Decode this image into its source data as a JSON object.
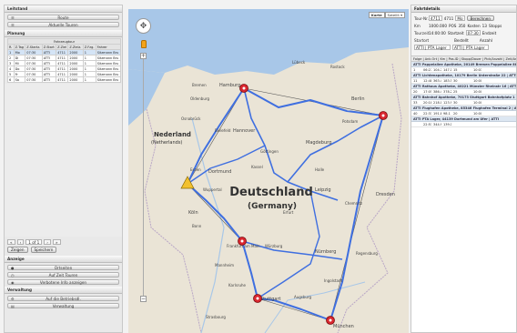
{
  "left": {
    "sections": {
      "leitstand": "Leitstand",
      "planung": "Planung",
      "anzeige": "Anzeige",
      "verwaltung": "Verwaltung"
    },
    "leitstand_buttons": [
      {
        "label": "Route",
        "icon": "list-icon"
      },
      {
        "label": "Aktuelle Touren",
        "icon": "list-icon"
      }
    ],
    "plan_table": {
      "group_header": "Fahrzeugtour",
      "columns": [
        "R.",
        "Z.Tag",
        "Z.Startz.",
        "Z.Start",
        "Z.Ziel",
        "Z.Zielz.",
        "Z.Fzg.",
        "Fahrer"
      ],
      "rows": [
        [
          "1",
          "Mo",
          "07:30",
          "ATTI",
          "4711",
          "2000",
          "1",
          "Sitzmann Bru"
        ],
        [
          "2",
          "Di",
          "07:30",
          "ATTI",
          "4711",
          "2000",
          "1",
          "Sitzmann Bru"
        ],
        [
          "3",
          "Mi",
          "07:30",
          "ATTI",
          "4711",
          "2000",
          "1",
          "Sitzmann Bru"
        ],
        [
          "4",
          "Do",
          "07:30",
          "ATTI",
          "4711",
          "2000",
          "1",
          "Sitzmann Bru"
        ],
        [
          "5",
          "Fr",
          "07:30",
          "ATTI",
          "4711",
          "2000",
          "1",
          "Sitzmann Bru"
        ],
        [
          "6",
          "Sa",
          "07:30",
          "ATTI",
          "4711",
          "2000",
          "1",
          "Sitzmann Bru"
        ]
      ]
    },
    "pager": {
      "first": "«",
      "prev": "‹",
      "page": "1 of 1",
      "next": "›",
      "last": "»"
    },
    "actions": {
      "zeigen": "Zeigen",
      "speichern": "Speichern"
    },
    "anzeige_buttons": [
      {
        "label": "Ortseiten",
        "icon": "pin-icon"
      },
      {
        "label": "Auf Zeit Touren",
        "icon": "clock-icon"
      },
      {
        "label": "Verbotene Info anzeigen",
        "icon": "eye-icon"
      }
    ],
    "verwaltung_buttons": [
      {
        "label": "Auf die Betriebsdl.",
        "icon": "gear-icon"
      },
      {
        "label": "Verwaltung",
        "icon": "folder-icon"
      }
    ]
  },
  "map": {
    "type_buttons": {
      "karte": "Karte",
      "satellit": "Satellit ▾"
    },
    "pan_glyph": "✥",
    "zoom_in": "+",
    "zoom_out": "−",
    "labels": [
      {
        "text": "Deutschland",
        "size": "big"
      },
      {
        "text": "(Germany)",
        "size": "big2"
      },
      {
        "text": "Nederland",
        "size": "mid"
      },
      {
        "text": "(Netherlands)",
        "size": "small"
      },
      {
        "text": "Hamburg"
      },
      {
        "text": "Bremen"
      },
      {
        "text": "Hannover"
      },
      {
        "text": "Berlin"
      },
      {
        "text": "Magdeburg"
      },
      {
        "text": "Leipzig"
      },
      {
        "text": "Dresden"
      },
      {
        "text": "Dortmund"
      },
      {
        "text": "Essen"
      },
      {
        "text": "Köln"
      },
      {
        "text": "Wuppertal"
      },
      {
        "text": "Kassel"
      },
      {
        "text": "Erfurt"
      },
      {
        "text": "Frankfurt am Main"
      },
      {
        "text": "Nürnberg"
      },
      {
        "text": "Stuttgart"
      },
      {
        "text": "München"
      },
      {
        "text": "Karlsruhe"
      },
      {
        "text": "Oldenburg"
      },
      {
        "text": "Bielefeld"
      },
      {
        "text": "Potsdam"
      },
      {
        "text": "Chemnitz"
      },
      {
        "text": "Regensburg"
      },
      {
        "text": "Augsburg"
      },
      {
        "text": "Mannheim"
      },
      {
        "text": "Würzburg"
      },
      {
        "text": "Osnabrück"
      },
      {
        "text": "Lübeck"
      },
      {
        "text": "Rostock"
      },
      {
        "text": "Bonn"
      },
      {
        "text": "Strasbourg"
      },
      {
        "text": "Ingolstadt"
      },
      {
        "text": "Halle"
      },
      {
        "text": "Göttingen"
      }
    ],
    "colors": {
      "land": "#eae4d6",
      "route": "#3f6fe0",
      "straight": "#555555",
      "marker": "#d9262e",
      "start": "#f2c12e",
      "water": "#a8c7e8"
    }
  },
  "right": {
    "title": "Fahrtdetails",
    "form": {
      "tour_label": "Tour-Nr.",
      "tour_value": "4711",
      "tag_label": "4711",
      "tag_value": "Mo",
      "berechnen": "Berechnen",
      "km_label": "Km",
      "km_value": "1000.000",
      "pos_label": "POS",
      "pos_value": "350",
      "kosten_label": "Kosten",
      "kosten_value": "13",
      "zeit_label": "Stopps",
      "tourzeit_label": "Tourzeit",
      "tourzeit_value": "14:00:00",
      "startzeit_label": "Startzeit",
      "startzeit_value": "07:30",
      "ende_label": "Endzeit",
      "startort_label": "Startort",
      "bestellt_label": "Bestellt",
      "anzahl_label": "Anzahl",
      "ziel_select": "ATTI | PTA Lager",
      "start_select": "ATTI | PTA Lager"
    },
    "list_header": "Folge | Ank.Ort | Km | Pos.ID | Stopp/Dauer | Pick/Anzahl | Zeit/Anzahl | Zeit ...",
    "groups": [
      {
        "title": "ATTI Pappelallee Apotheke, 20149 Bremen Pappelallee 88 | ATTI",
        "row": [
          "1",
          "06:27",
          "104.7",
          "147.1",
          "15",
          "",
          "10:03"
        ]
      },
      {
        "title": "ATTI Lichtenapotheke, 10179 Berlin Unterstraße 22 | ATTI",
        "row": [
          "11",
          "12:48",
          "363.4",
          "183.5",
          "30",
          "",
          "10:00"
        ]
      },
      {
        "title": "ATTI Rathaus Apotheke, 40221 Münster Rheinstr 16 | ATTI",
        "row": [
          "20",
          "17:05",
          "386.4",
          "378.2",
          "25",
          "",
          "10:00"
        ]
      },
      {
        "title": "ATTI Bahnhof Apotheke, 70173 Stuttgart Bahnhofplatz 1 | ATTI",
        "row": [
          "33",
          "20:18",
          "218.0",
          "123.9",
          "30",
          "",
          "10:00"
        ]
      },
      {
        "title": "ATTI Flughafen Apotheke, 85346 Flughafen Terminal 2 | ATTI",
        "row": [
          "40",
          "22:31",
          "191.8",
          "98.1",
          "20",
          "",
          "10:00"
        ]
      },
      {
        "title": "ATTI PTA Lager, 44139 Dortmund am Ufer | ATTI",
        "row": [
          "",
          "22:51",
          "344.9",
          "139.1",
          "",
          "",
          ""
        ]
      }
    ]
  }
}
